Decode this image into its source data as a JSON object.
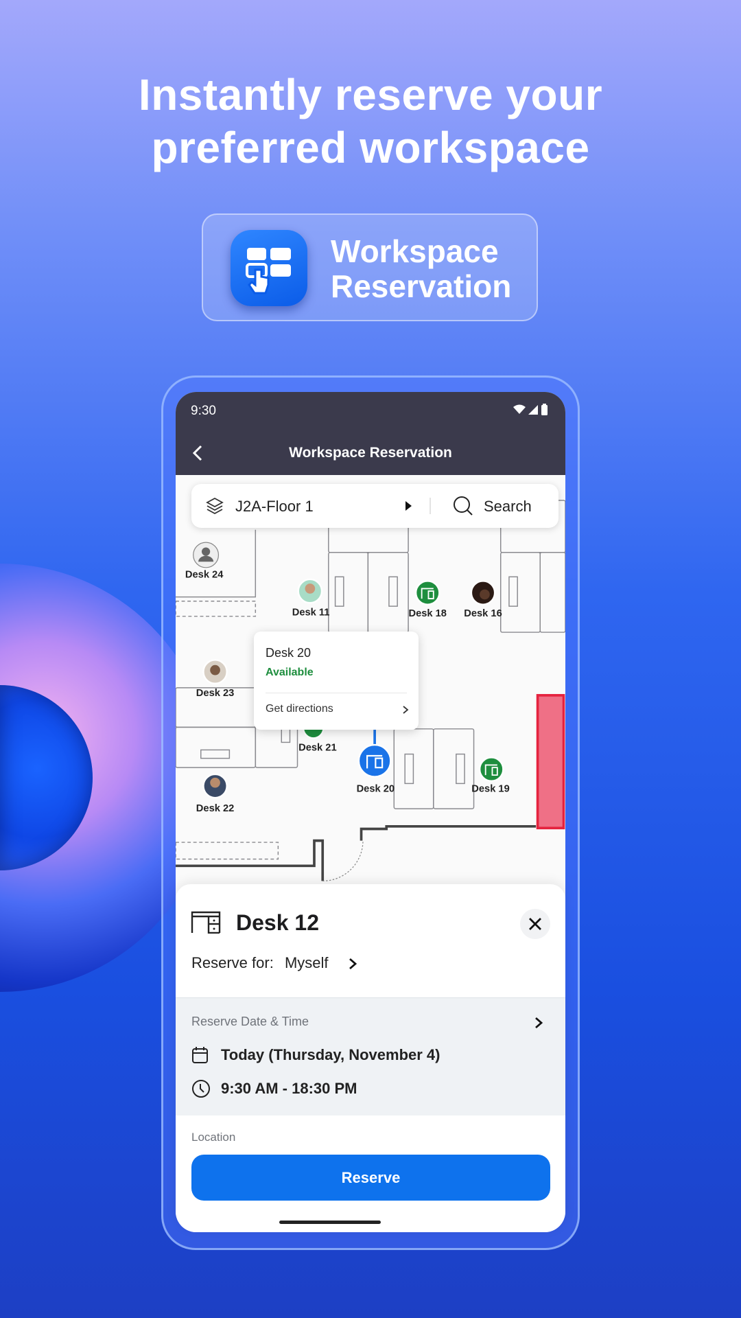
{
  "promo": {
    "headline_line1": "Instantly reserve your",
    "headline_line2": "preferred workspace",
    "badge_line1": "Workspace",
    "badge_line2": "Reservation"
  },
  "status_bar": {
    "time": "9:30"
  },
  "header": {
    "title": "Workspace Reservation"
  },
  "floor_bar": {
    "floor": "J2A-Floor 1",
    "search_label": "Search"
  },
  "map": {
    "desks": [
      {
        "label": "Desk 24",
        "status": "unknown"
      },
      {
        "label": "Desk 11",
        "status": "occupied"
      },
      {
        "label": "Desk 18",
        "status": "available"
      },
      {
        "label": "Desk 16",
        "status": "occupied"
      },
      {
        "label": "Desk 23",
        "status": "occupied"
      },
      {
        "label": "Desk 21",
        "status": "available"
      },
      {
        "label": "Desk 20",
        "status": "selected"
      },
      {
        "label": "Desk 19",
        "status": "available"
      },
      {
        "label": "Desk 22",
        "status": "occupied"
      }
    ],
    "popup": {
      "title": "Desk 20",
      "status": "Available",
      "action": "Get directions"
    }
  },
  "sheet": {
    "title": "Desk 12",
    "reserve_for_label": "Reserve for:",
    "reserve_for_value": "Myself",
    "date_time_label": "Reserve Date & Time",
    "date": "Today (Thursday, November 4)",
    "time_range": "9:30 AM - 18:30 PM",
    "location_label": "Location",
    "reserve_button": "Reserve"
  },
  "colors": {
    "accent": "#0e72ed",
    "available": "#1e8e3e",
    "selected": "#1a73e8",
    "restricted": "#e5233f",
    "header": "#3b3a4c"
  }
}
